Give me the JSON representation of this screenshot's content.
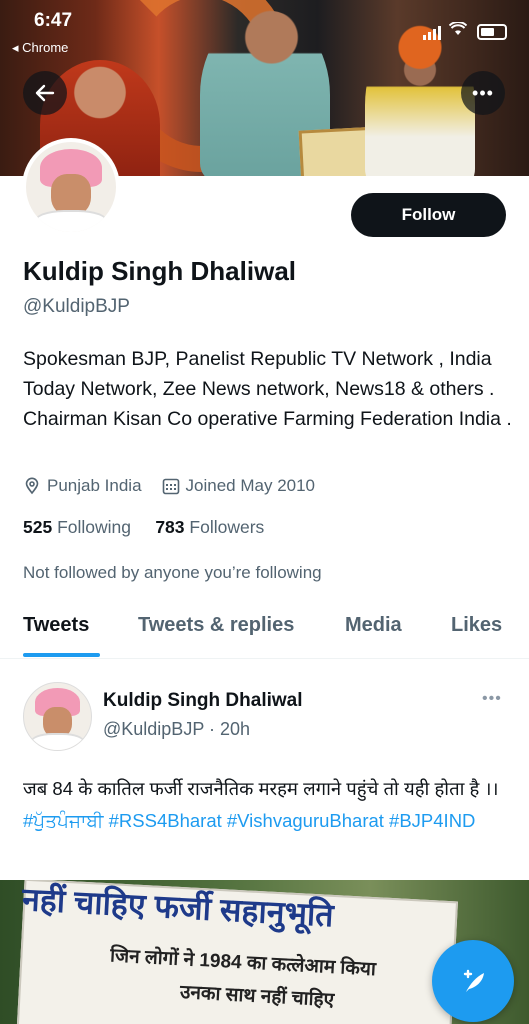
{
  "status_bar": {
    "time": "6:47",
    "back_app": "◂ Chrome"
  },
  "profile": {
    "name": "Kuldip Singh Dhaliwal",
    "handle": "@KuldipBJP",
    "follow_label": "Follow",
    "bio": "Spokesman BJP, Panelist Republic TV Network , India Today Network, Zee News network, News18 & others . Chairman Kisan Co operative Farming Federation India .",
    "location": "Punjab India",
    "joined": "Joined May 2010",
    "following_count": "525",
    "following_label": "Following",
    "followers_count": "783",
    "followers_label": "Followers",
    "not_followed": "Not followed by anyone you’re following"
  },
  "tabs": [
    {
      "label": "Tweets",
      "active": true
    },
    {
      "label": "Tweets & replies",
      "active": false
    },
    {
      "label": "Media",
      "active": false
    },
    {
      "label": "Likes",
      "active": false
    }
  ],
  "tweet": {
    "name": "Kuldip Singh Dhaliwal",
    "handle_time": "@KuldipBJP · 20h",
    "text": "जब 84 के कातिल फर्जी राजनैतिक मरहम लगाने पहुंचे तो यही होता है ।।",
    "hashtags": [
      "#ਪੁੱਤਪੰਜਾਬੀ",
      "#RSS4Bharat",
      "#VishvaguruBharat",
      "#BJP4IND"
    ],
    "image_text": {
      "heading": "नहीं चाहिए फर्जी सहानुभूति",
      "line1": "जिन लोगों ने 1984 का कत्लेआम किया",
      "line2": "उनका साथ नहीं चाहिए"
    }
  },
  "colors": {
    "accent": "#1d9bf0",
    "text": "#0f1419",
    "secondary": "#536471"
  }
}
